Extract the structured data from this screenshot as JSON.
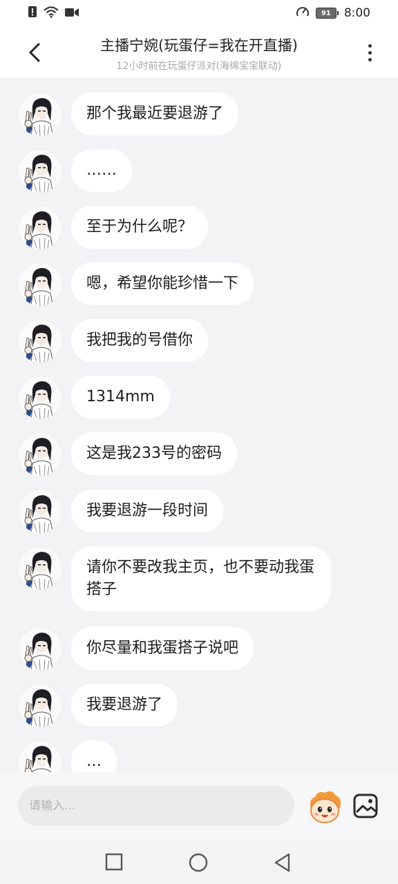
{
  "status_bar": {
    "time": "8:00",
    "battery": "91",
    "icons": [
      "notification-alert-icon",
      "wifi-icon",
      "video-icon",
      "speed-gauge-icon",
      "battery-icon"
    ]
  },
  "header": {
    "title": "主播宁婉(玩蛋仔=我在开直播)",
    "subtitle": "12小时前在玩蛋仔派对(海绵宝宝联动)",
    "back_icon": "chevron-left-icon",
    "more_icon": "more-vertical-icon"
  },
  "messages": [
    {
      "text": "那个我最近要退游了"
    },
    {
      "text": "……"
    },
    {
      "text": "至于为什么呢？"
    },
    {
      "text": "嗯，希望你能珍惜一下"
    },
    {
      "text": "我把我的号借你"
    },
    {
      "text": "1314mm"
    },
    {
      "text": "这是我233号的密码"
    },
    {
      "text": "我要退游一段时间"
    },
    {
      "text": "请你不要改我主页，也不要动我蛋搭子"
    },
    {
      "text": "你尽量和我蛋搭子说吧"
    },
    {
      "text": "我要退游了"
    },
    {
      "text": "…"
    }
  ],
  "input": {
    "placeholder": "请输入...",
    "value": "",
    "emoji_icon": "eggy-emoji-icon",
    "image_icon": "image-icon"
  },
  "nav": {
    "icons": [
      "recent-apps-square-icon",
      "home-circle-icon",
      "back-triangle-icon"
    ]
  },
  "colors": {
    "background": "#f3f3f5",
    "bubble": "#ffffff",
    "text": "#1c1c1c",
    "subtitle": "#a7a7a7"
  }
}
